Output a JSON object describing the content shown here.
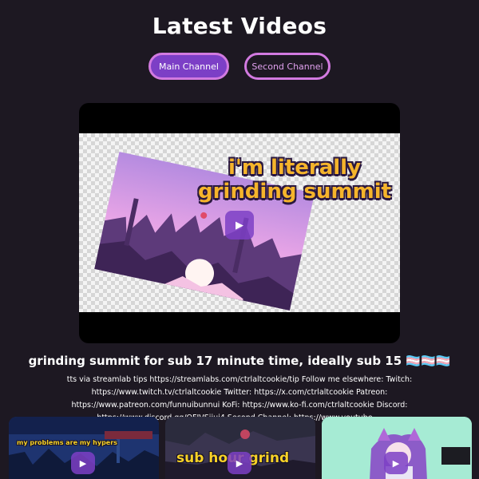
{
  "header": {
    "title": "Latest Videos"
  },
  "tabs": [
    {
      "label": "Main Channel",
      "active": true
    },
    {
      "label": "Second Channel",
      "active": false
    }
  ],
  "featured": {
    "overlay_line1": "i'm literally",
    "overlay_line2": "grinding summit",
    "play_icon": "▶",
    "title": "grinding summit for sub 17 minute time, ideally sub 15 🏳️‍⚧️🏳️‍⚧️🏳️‍⚧️",
    "description": "tts via streamlab tips https://streamlabs.com/ctrlaltcookie/tip Follow me elsewhere: Twitch: https://www.twitch.tv/ctrlaltcookie Twitter: https://x.com/ctrlaltcookie Patreon: https://www.patreon.com/funnuibunnui KoFi: https://www.ko-fi.com/ctrlaltcookie Discord: https://www.discord.gg/QFJVSjjuj4 Second Channel: https://www.youtube...."
  },
  "cards": [
    {
      "overlay": "my problems are my hypers",
      "play_icon": "▶"
    },
    {
      "overlay": "sub hour grind",
      "play_icon": "▶"
    },
    {
      "overlay": "",
      "play_icon": "▶"
    }
  ],
  "colors": {
    "background": "#1d1822",
    "accent": "#7c3fc6",
    "accent_border": "#d27ae0",
    "overlay_text": "#f5b42b"
  },
  "icons": {
    "play": "play-icon"
  }
}
